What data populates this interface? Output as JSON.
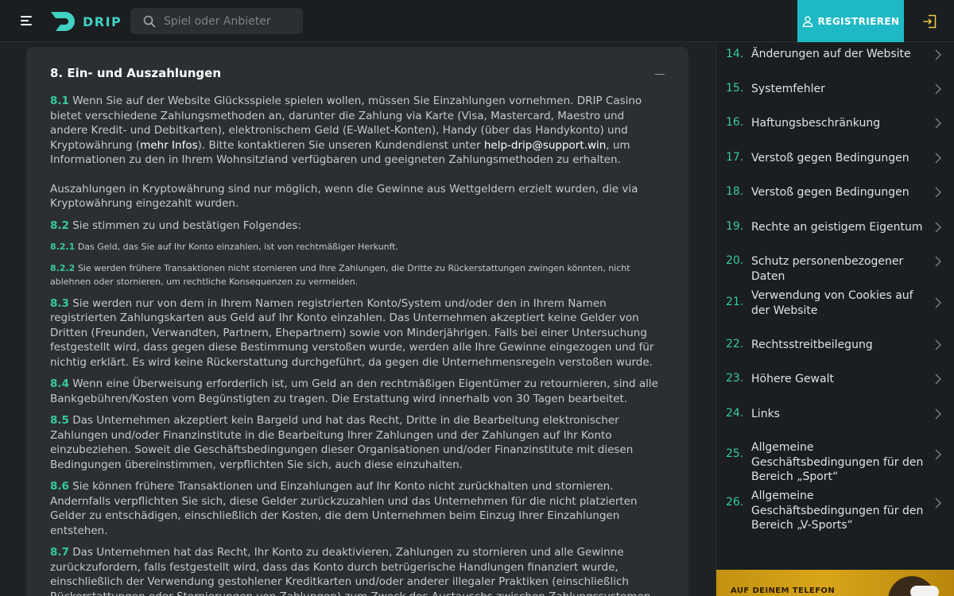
{
  "header": {
    "logo_text": "DRIP",
    "search_placeholder": "Spiel oder Anbieter",
    "register_label": "REGISTRIEREN"
  },
  "section": {
    "title": "8. Ein- und Auszahlungen",
    "p1_num": "8.1",
    "p1_a": " Wenn Sie auf der Website Glücksspiele spielen wollen, müssen Sie Einzahlungen vornehmen. DRIP Casino bietet verschiedene Zahlungsmethoden an, darunter die Zahlung via Karte (Visa, Mastercard, Maestro und andere Kredit- und Debitkarten), elektronischem Geld (E-Wallet-Konten), Handy (über das Handykonto) und Kryptowährung (",
    "p1_link1": "mehr Infos",
    "p1_b": "). Bitte kontaktieren Sie unseren Kundendienst unter ",
    "p1_link2": "help-drip@support.win",
    "p1_c": ", um Informationen zu den in Ihrem Wohnsitzland verfügbaren und geeigneten Zahlungsmethoden zu erhalten.",
    "p1_extra": "Auszahlungen in Kryptowährung sind nur möglich, wenn die Gewinne aus Wettgeldern erzielt wurden, die via Kryptowährung eingezahlt wurden.",
    "p2_num": "8.2",
    "p2_text": " Sie stimmen zu und bestätigen Folgendes:",
    "p21_num": "8.2.1",
    "p21_text": " Das Geld, das Sie auf Ihr Konto einzahlen, ist von rechtmäßiger Herkunft.",
    "p22_num": "8.2.2",
    "p22_text": " Sie werden frühere Transaktionen nicht stornieren und Ihre Zahlungen, die Dritte zu Rückerstattungen zwingen könnten, nicht ablehnen oder stornieren, um rechtliche Konsequenzen zu vermeiden.",
    "p3_num": "8.3",
    "p3_text": " Sie werden nur von dem in Ihrem Namen registrierten Konto/System und/oder den in Ihrem Namen registrierten Zahlungskarten aus Geld auf Ihr Konto einzahlen. Das Unternehmen akzeptiert keine Gelder von Dritten (Freunden, Verwandten, Partnern, Ehepartnern) sowie von Minderjährigen. Falls bei einer Untersuchung festgestellt wird, dass gegen diese Bestimmung verstoßen wurde, werden alle Ihre Gewinne eingezogen und für nichtig erklärt. Es wird keine Rückerstattung durchgeführt, da gegen die Unternehmensregeln verstoßen wurde.",
    "p4_num": "8.4",
    "p4_text": " Wenn eine Überweisung erforderlich ist, um Geld an den rechtmäßigen Eigentümer zu retournieren, sind alle Bankgebühren/Kosten vom Begünstigten zu tragen. Die Erstattung wird innerhalb von 30 Tagen bearbeitet.",
    "p5_num": "8.5",
    "p5_text": " Das Unternehmen akzeptiert kein Bargeld und hat das Recht, Dritte in die Bearbeitung elektronischer Zahlungen und/oder Finanzinstitute in die Bearbeitung Ihrer Zahlungen und der Zahlungen auf Ihr Konto einzubeziehen. Soweit die Geschäftsbedingungen dieser Organisationen und/oder Finanzinstitute mit diesen Bedingungen übereinstimmen, verpflichten Sie sich, auch diese einzuhalten.",
    "p6_num": "8.6",
    "p6_text": " Sie können frühere Transaktionen und Einzahlungen auf Ihr Konto nicht zurückhalten und stornieren. Andernfalls verpflichten Sie sich, diese Gelder zurückzuzahlen und das Unternehmen für die nicht platzierten Gelder zu entschädigen, einschließlich der Kosten, die dem Unternehmen beim Einzug Ihrer Einzahlungen entstehen.",
    "p7_num": "8.7",
    "p7_text": " Das Unternehmen hat das Recht, Ihr Konto zu deaktivieren, Zahlungen zu stornieren und alle Gewinne zurückzufordern, falls festgestellt wird, dass das Konto durch betrügerische Handlungen finanziert wurde, einschließlich der Verwendung gestohlener Kreditkarten und/oder anderer illegaler Praktiken (einschließlich Rückerstattungen oder Stornierungen von Zahlungen) zum Zweck des Austauschs zwischen Zahlungssystemen. Das Unternehmen behält sich das Recht vor, Behörden"
  },
  "toc": [
    {
      "num": "14.",
      "label": "Änderungen auf der Website"
    },
    {
      "num": "15.",
      "label": "Systemfehler"
    },
    {
      "num": "16.",
      "label": "Haftungsbeschränkung"
    },
    {
      "num": "17.",
      "label": "Verstoß gegen Bedingungen"
    },
    {
      "num": "18.",
      "label": "Verstoß gegen Bedingungen"
    },
    {
      "num": "19.",
      "label": "Rechte an geistigem Eigentum"
    },
    {
      "num": "20.",
      "label": "Schutz personenbezogener Daten"
    },
    {
      "num": "21.",
      "label": "Verwendung von Cookies auf der Website"
    },
    {
      "num": "22.",
      "label": "Rechtsstreitbeilegung"
    },
    {
      "num": "23.",
      "label": "Höhere Gewalt"
    },
    {
      "num": "24.",
      "label": "Links"
    },
    {
      "num": "25.",
      "label": "Allgemeine Geschäftsbedingungen für den Bereich „Sport“"
    },
    {
      "num": "26.",
      "label": "Allgemeine Geschäftsbedingungen für den Bereich „V-Sports“"
    }
  ],
  "promo": {
    "text": "AUF DEINEM TELEFON"
  },
  "colors": {
    "accent": "#36c9a0",
    "register_bg": "#1fb9c5",
    "brand_logo": "#3fd1c2",
    "promo_bg": "#d9a51a"
  },
  "icons": [
    "menu-icon",
    "logo-mark-icon",
    "search-icon",
    "user-icon",
    "login-icon",
    "collapse-icon",
    "chevron-right-icon"
  ]
}
